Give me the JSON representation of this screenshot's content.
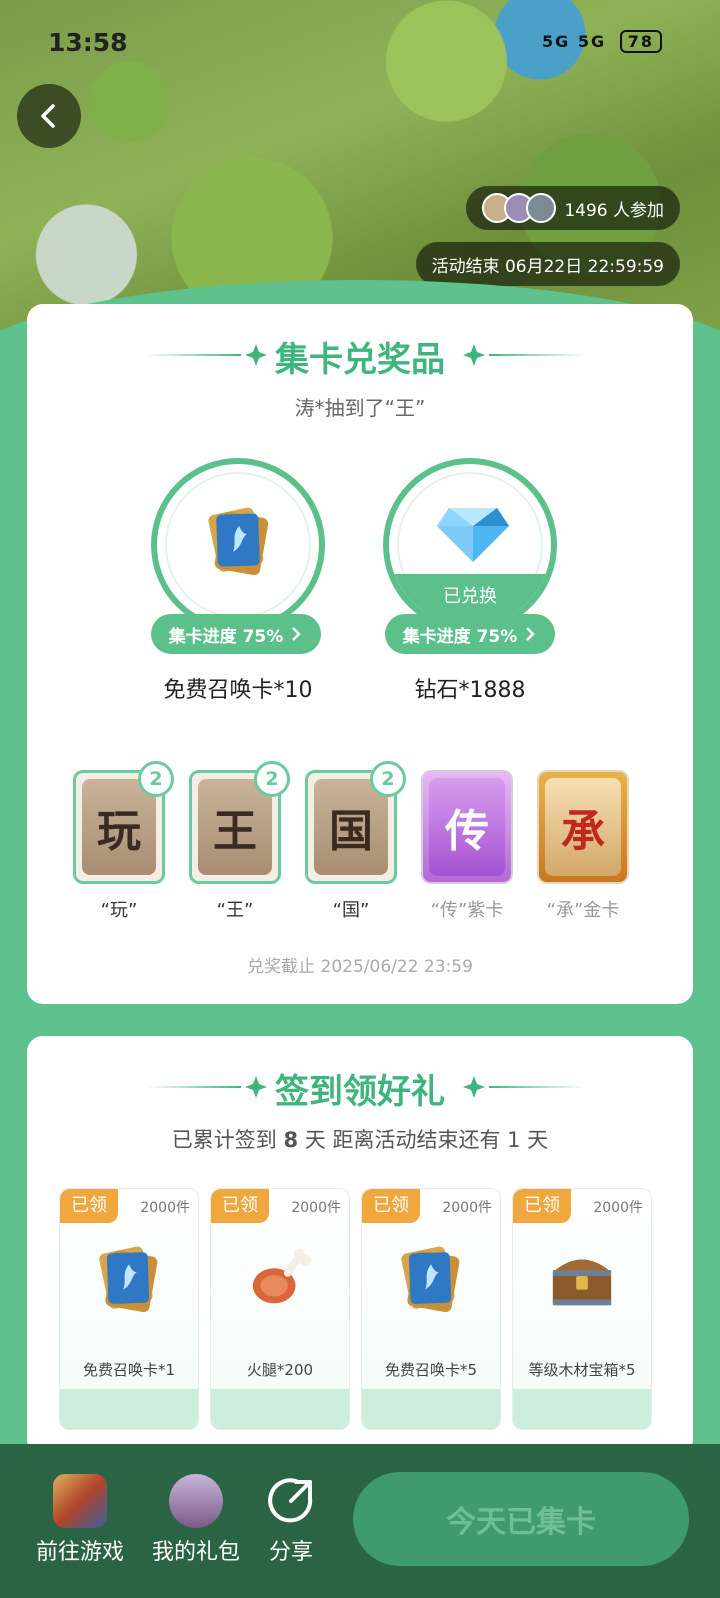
{
  "status_bar": {
    "time": "13:58",
    "signal": "5G 5G",
    "battery": "78"
  },
  "hero": {
    "participants": "1496 人参加",
    "end_time": "活动结束 06月22日 22:59:59"
  },
  "collect": {
    "title": "集卡兑奖品",
    "ticker": "涛*抽到了“王”",
    "prizes": [
      {
        "name": "免费召唤卡*10",
        "progress": "集卡进度 75%",
        "redeemed": ""
      },
      {
        "name": "钻石*1888",
        "progress": "集卡进度 75%",
        "redeemed": "已兑换"
      }
    ],
    "cards": [
      {
        "char": "玩",
        "label": "“玩”",
        "count": "2"
      },
      {
        "char": "王",
        "label": "“王”",
        "count": "2"
      },
      {
        "char": "国",
        "label": "“国”",
        "count": "2"
      },
      {
        "char": "传",
        "label": "“传”紫卡"
      },
      {
        "char": "承",
        "label": "“承”金卡"
      }
    ],
    "deadline": "兑奖截止 2025/06/22 23:59"
  },
  "signin": {
    "title": "签到领好礼",
    "summary_prefix": "已累计签到",
    "days_signed": "8",
    "summary_suffix": "天  距离活动结束还有 1 天",
    "rewards": [
      {
        "tag": "已领",
        "qty": "2000件",
        "name": "免费召唤卡*1"
      },
      {
        "tag": "已领",
        "qty": "2000件",
        "name": "火腿*200"
      },
      {
        "tag": "已领",
        "qty": "2000件",
        "name": "免费召唤卡*5"
      },
      {
        "tag": "已领",
        "qty": "2000件",
        "name": "等级木材宝箱*5"
      }
    ]
  },
  "bottom_bar": {
    "go_game": "前往游戏",
    "my_gifts": "我的礼包",
    "share": "分享",
    "cta": "今天已集卡"
  },
  "colors": {
    "primary": "#5cc08b",
    "title_green": "#3fb57d",
    "tag_orange": "#f0a73e",
    "bar_dark": "#2b6445"
  }
}
